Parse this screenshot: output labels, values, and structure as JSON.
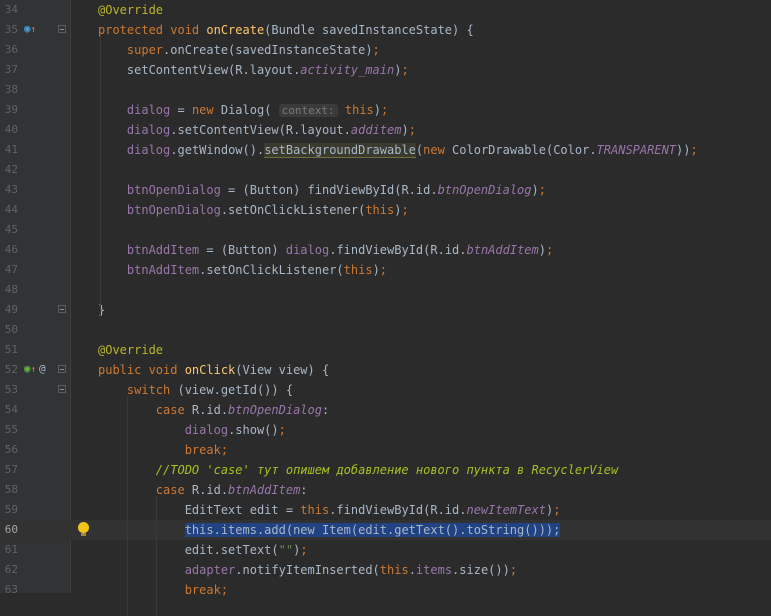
{
  "lines": [
    {
      "n": "34",
      "mk": "",
      "fold": false,
      "tokens": [
        {
          "t": "@Override",
          "c": "a"
        }
      ]
    },
    {
      "n": "35",
      "mk": "override-up",
      "fold": true,
      "tokens": [
        {
          "t": "protected void ",
          "c": "k"
        },
        {
          "t": "onCreate",
          "c": "m"
        },
        {
          "t": "(Bundle savedInstanceState) {",
          "c": "p"
        }
      ]
    },
    {
      "n": "36",
      "mk": "",
      "fold": false,
      "tokens": [
        {
          "t": "    "
        },
        {
          "t": "super",
          "c": "k"
        },
        {
          "t": ".onCreate(savedInstanceState)",
          "c": "p"
        },
        {
          "t": ";",
          "c": "k"
        }
      ]
    },
    {
      "n": "37",
      "mk": "",
      "fold": false,
      "tokens": [
        {
          "t": "    setContentView(R.layout."
        },
        {
          "t": "activity_main",
          "c": "fi"
        },
        {
          "t": ")",
          "c": "p"
        },
        {
          "t": ";",
          "c": "k"
        }
      ]
    },
    {
      "n": "38",
      "mk": "",
      "fold": false,
      "tokens": []
    },
    {
      "n": "39",
      "mk": "",
      "fold": false,
      "tokens": [
        {
          "t": "    "
        },
        {
          "t": "dialog",
          "c": "f"
        },
        {
          "t": " = "
        },
        {
          "t": "new ",
          "c": "k"
        },
        {
          "t": "Dialog( "
        },
        {
          "t": "context:",
          "c": "hint"
        },
        {
          "t": " "
        },
        {
          "t": "this",
          "c": "k"
        },
        {
          "t": ")",
          "c": "p"
        },
        {
          "t": ";",
          "c": "k"
        }
      ]
    },
    {
      "n": "40",
      "mk": "",
      "fold": false,
      "tokens": [
        {
          "t": "    "
        },
        {
          "t": "dialog",
          "c": "f"
        },
        {
          "t": ".setContentView(R.layout."
        },
        {
          "t": "additem",
          "c": "fi"
        },
        {
          "t": ")"
        },
        {
          "t": ";",
          "c": "k"
        }
      ]
    },
    {
      "n": "41",
      "mk": "",
      "fold": false,
      "tokens": [
        {
          "t": "    "
        },
        {
          "t": "dialog",
          "c": "f"
        },
        {
          "t": ".getWindow()."
        },
        {
          "t": "setBackgroundDrawable",
          "c": "hl"
        },
        {
          "t": "("
        },
        {
          "t": "new ",
          "c": "k"
        },
        {
          "t": "ColorDrawable(Color."
        },
        {
          "t": "TRANSPARENT",
          "c": "fi"
        },
        {
          "t": "))"
        },
        {
          "t": ";",
          "c": "k"
        }
      ]
    },
    {
      "n": "42",
      "mk": "",
      "fold": false,
      "tokens": []
    },
    {
      "n": "43",
      "mk": "",
      "fold": false,
      "tokens": [
        {
          "t": "    "
        },
        {
          "t": "btnOpenDialog",
          "c": "f"
        },
        {
          "t": " = (Button) findViewById(R.id."
        },
        {
          "t": "btnOpenDialog",
          "c": "fi"
        },
        {
          "t": ")"
        },
        {
          "t": ";",
          "c": "k"
        }
      ]
    },
    {
      "n": "44",
      "mk": "",
      "fold": false,
      "tokens": [
        {
          "t": "    "
        },
        {
          "t": "btnOpenDialog",
          "c": "f"
        },
        {
          "t": ".setOnClickListener("
        },
        {
          "t": "this",
          "c": "k"
        },
        {
          "t": ")"
        },
        {
          "t": ";",
          "c": "k"
        }
      ]
    },
    {
      "n": "45",
      "mk": "",
      "fold": false,
      "tokens": []
    },
    {
      "n": "46",
      "mk": "",
      "fold": false,
      "tokens": [
        {
          "t": "    "
        },
        {
          "t": "btnAddItem",
          "c": "f"
        },
        {
          "t": " = (Button) "
        },
        {
          "t": "dialog",
          "c": "f"
        },
        {
          "t": ".findViewById(R.id."
        },
        {
          "t": "btnAddItem",
          "c": "fi"
        },
        {
          "t": ")"
        },
        {
          "t": ";",
          "c": "k"
        }
      ]
    },
    {
      "n": "47",
      "mk": "",
      "fold": false,
      "tokens": [
        {
          "t": "    "
        },
        {
          "t": "btnAddItem",
          "c": "f"
        },
        {
          "t": ".setOnClickListener("
        },
        {
          "t": "this",
          "c": "k"
        },
        {
          "t": ")"
        },
        {
          "t": ";",
          "c": "k"
        }
      ]
    },
    {
      "n": "48",
      "mk": "",
      "fold": false,
      "tokens": []
    },
    {
      "n": "49",
      "mk": "",
      "fold": true,
      "tokens": [
        {
          "t": "}"
        }
      ]
    },
    {
      "n": "50",
      "mk": "",
      "fold": false,
      "tokens": []
    },
    {
      "n": "51",
      "mk": "",
      "fold": false,
      "tokens": [
        {
          "t": "@Override",
          "c": "a"
        }
      ]
    },
    {
      "n": "52",
      "mk": "implements-up-at",
      "fold": true,
      "tokens": [
        {
          "t": "public void ",
          "c": "k"
        },
        {
          "t": "onClick",
          "c": "m"
        },
        {
          "t": "(View view) {"
        }
      ]
    },
    {
      "n": "53",
      "mk": "",
      "fold": true,
      "tokens": [
        {
          "t": "    "
        },
        {
          "t": "switch ",
          "c": "k"
        },
        {
          "t": "(view.getId()) {"
        }
      ]
    },
    {
      "n": "54",
      "mk": "",
      "fold": false,
      "tokens": [
        {
          "t": "        "
        },
        {
          "t": "case ",
          "c": "k"
        },
        {
          "t": "R.id."
        },
        {
          "t": "btnOpenDialog",
          "c": "fi"
        },
        {
          "t": ":"
        }
      ]
    },
    {
      "n": "55",
      "mk": "",
      "fold": false,
      "tokens": [
        {
          "t": "            "
        },
        {
          "t": "dialog",
          "c": "f"
        },
        {
          "t": ".show()"
        },
        {
          "t": ";",
          "c": "k"
        }
      ]
    },
    {
      "n": "56",
      "mk": "",
      "fold": false,
      "tokens": [
        {
          "t": "            "
        },
        {
          "t": "break;",
          "c": "k"
        }
      ]
    },
    {
      "n": "57",
      "mk": "",
      "fold": false,
      "tokens": [
        {
          "t": "        "
        },
        {
          "t": "//TODO 'case' тут опишем добавление нового пункта в RecyclerView",
          "c": "t"
        }
      ]
    },
    {
      "n": "58",
      "mk": "",
      "fold": false,
      "tokens": [
        {
          "t": "        "
        },
        {
          "t": "case ",
          "c": "k"
        },
        {
          "t": "R.id."
        },
        {
          "t": "btnAddItem",
          "c": "fi"
        },
        {
          "t": ":"
        }
      ]
    },
    {
      "n": "59",
      "mk": "",
      "fold": false,
      "tokens": [
        {
          "t": "            EditText edit = "
        },
        {
          "t": "this",
          "c": "k"
        },
        {
          "t": ".findViewById(R.id."
        },
        {
          "t": "newItemText",
          "c": "fi"
        },
        {
          "t": ")"
        },
        {
          "t": ";",
          "c": "k"
        }
      ]
    },
    {
      "n": "60",
      "mk": "bulb",
      "fold": false,
      "current": true,
      "tokens": [
        {
          "t": "            "
        },
        {
          "t": "this.items.add(new Item(edit.getText().toString()));",
          "c": "sel"
        }
      ]
    },
    {
      "n": "61",
      "mk": "",
      "fold": false,
      "tokens": [
        {
          "t": "            edit.setText("
        },
        {
          "t": "\"\"",
          "c": "s"
        },
        {
          "t": ")"
        },
        {
          "t": ";",
          "c": "k"
        }
      ]
    },
    {
      "n": "62",
      "mk": "",
      "fold": false,
      "tokens": [
        {
          "t": "            "
        },
        {
          "t": "adapter",
          "c": "f"
        },
        {
          "t": ".notifyItemInserted("
        },
        {
          "t": "this",
          "c": "k"
        },
        {
          "t": "."
        },
        {
          "t": "items",
          "c": "f"
        },
        {
          "t": ".size())"
        },
        {
          "t": ";",
          "c": "k"
        }
      ]
    },
    {
      "n": "63",
      "mk": "",
      "fold": false,
      "tokens": [
        {
          "t": "            "
        },
        {
          "t": "break;",
          "c": "k"
        }
      ]
    }
  ],
  "gutter_icons": {
    "override": "override-method-icon",
    "implements": "implements-method-icon",
    "at": "annotation-at-icon",
    "bulb": "intention-lightbulb-icon"
  },
  "colors": {
    "background": "#2b2b2b",
    "keyword": "#cc7832",
    "annotation": "#bbb529",
    "method": "#ffc66d",
    "field": "#9876aa",
    "string": "#6a8759",
    "todo": "#a8c023",
    "selection": "#214283"
  }
}
